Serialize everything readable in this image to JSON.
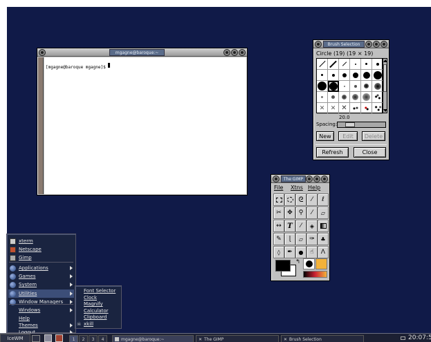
{
  "terminal": {
    "title": "mgagne@baroque:~",
    "prompt": "[mgagne@baroque mgagne]$ "
  },
  "brush": {
    "title": "Brush Selection",
    "brush_name": "Circle (19)  (19 × 19)",
    "spacing_value": "20.0",
    "spacing_label": "Spacing:",
    "spacing_fraction": 0.2,
    "new_label": "New",
    "edit_label": "Edit",
    "delete_label": "Delete",
    "refresh_label": "Refresh",
    "close_label": "Close"
  },
  "gimp": {
    "title": "The GIMP",
    "menu_file": "File",
    "menu_xtns": "Xtns",
    "menu_help": "Help",
    "fg_color": "#000000",
    "bg_color": "#ffffff"
  },
  "startmenu": {
    "items": [
      {
        "label": "xterm",
        "icon": "terminal-icon"
      },
      {
        "label": "Netscape",
        "icon": "netscape-icon"
      },
      {
        "label": "Gimp",
        "icon": "gimp-icon"
      },
      {
        "label": "Applications",
        "icon": "folder-icon",
        "submenu": true
      },
      {
        "label": "Games",
        "icon": "folder-icon",
        "submenu": true
      },
      {
        "label": "System",
        "icon": "folder-icon",
        "submenu": true
      },
      {
        "label": "Utilities",
        "icon": "folder-icon",
        "submenu": true
      },
      {
        "label": "Window Managers",
        "icon": "folder-icon",
        "submenu": true
      },
      {
        "label": "Windows",
        "icon": "",
        "submenu": true
      },
      {
        "label": "Help",
        "icon": ""
      },
      {
        "label": "Themes",
        "icon": "",
        "submenu": true
      },
      {
        "label": "Logout...",
        "icon": "",
        "submenu": true
      }
    ],
    "submenu": [
      "Font Selector",
      "Clock",
      "Magnify",
      "Calculator",
      "Clipboard",
      "xkill"
    ]
  },
  "taskbar": {
    "start_label": "IceWM",
    "workspaces": [
      "1",
      "2",
      "3",
      "4"
    ],
    "tasks": [
      "mgagne@baroque:~",
      "The GIMP",
      "Brush Selection"
    ],
    "clock": "20:07:5"
  }
}
